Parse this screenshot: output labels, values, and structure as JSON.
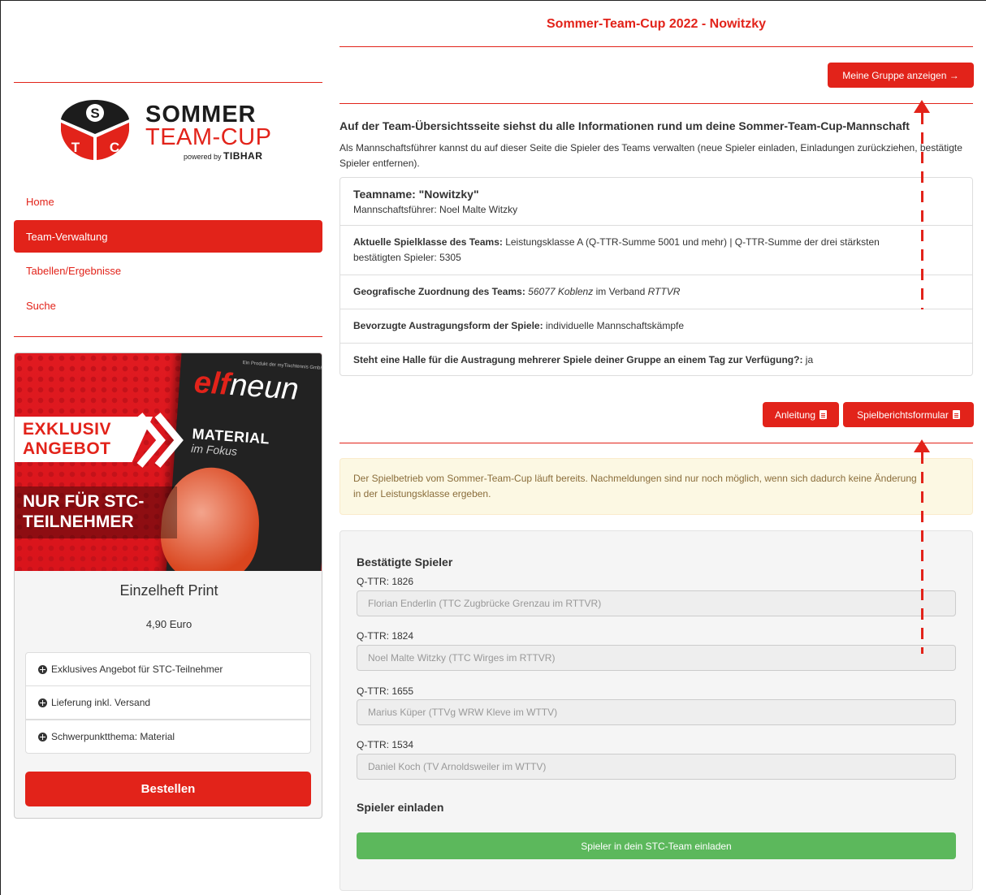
{
  "header": {
    "title": "Sommer-Team-Cup 2022 - Nowitzky"
  },
  "logo": {
    "line1": "SOMMER",
    "line2": "TEAM-CUP",
    "powered": "powered by",
    "brand": "TIBHAR",
    "letters": [
      "S",
      "T",
      "C"
    ]
  },
  "nav": {
    "items": [
      "Home",
      "Team-Verwaltung",
      "Tabellen/Ergebnisse",
      "Suche"
    ],
    "active_index": 1
  },
  "ad": {
    "badge1": "EXKLUSIV",
    "badge2": "ANGEBOT",
    "headline1": "NUR FÜR STC-",
    "headline2": "TEILNEHMER",
    "magazine_small": "Ein Produkt der myTischtennis GmbH",
    "magazine_title_a": "elf",
    "magazine_title_b": "neun",
    "magazine_topic": "MATERIAL",
    "magazine_sub": "im Fokus",
    "product": "Einzelheft Print",
    "price": "4,90 Euro",
    "features": [
      "Exklusives Angebot für STC-Teilnehmer",
      "Lieferung inkl. Versand",
      "Schwerpunktthema: Material"
    ],
    "order_button": "Bestellen"
  },
  "top_button": "Meine Gruppe anzeigen →",
  "overview": {
    "heading": "Auf der Team-Übersichtsseite siehst du alle Informationen rund um deine Sommer-Team-Cup-Mannschaft",
    "text": "Als Mannschaftsführer kannst du auf dieser Seite die Spieler des Teams verwalten (neue Spieler einladen, Einladungen zurückziehen, bestätigte Spieler entfernen)."
  },
  "team": {
    "name": "Teamname: \"Nowitzky\"",
    "captain": "Mannschaftsführer: Noel Malte Witzky",
    "class_label": "Aktuelle Spielklasse des Teams:",
    "class_value": " Leistungsklasse A (Q-TTR-Summe 5001 und mehr) | Q-TTR-Summe der drei stärksten bestätigten Spieler: 5305",
    "geo_label": "Geografische Zuordnung des Teams:",
    "geo_place": "56077 Koblenz",
    "geo_mid": " im Verband ",
    "geo_assoc": "RTTVR",
    "form_label": "Bevorzugte Austragungsform der Spiele:",
    "form_value": " individuelle Mannschaftskämpfe",
    "hall_label": "Steht eine Halle für die Austragung mehrerer Spiele deiner Gruppe an einem Tag zur Verfügung?:",
    "hall_value": " ja"
  },
  "doc_buttons": {
    "guide": "Anleitung",
    "report": "Spielberichtsformular"
  },
  "notice": "Der Spielbetrieb vom Sommer-Team-Cup läuft bereits. Nachmeldungen sind nur noch möglich, wenn sich dadurch keine Änderung in der Leistungsklasse ergeben.",
  "players": {
    "heading": "Bestätigte Spieler",
    "list": [
      {
        "qttr": "Q-TTR: 1826",
        "name": "Florian Enderlin (TTC Zugbrücke Grenzau im RTTVR)"
      },
      {
        "qttr": "Q-TTR: 1824",
        "name": "Noel Malte Witzky (TTC Wirges im RTTVR)"
      },
      {
        "qttr": "Q-TTR: 1655",
        "name": "Marius Küper (TTVg WRW Kleve im WTTV)"
      },
      {
        "qttr": "Q-TTR: 1534",
        "name": "Daniel Koch (TV Arnoldsweiler im WTTV)"
      }
    ],
    "invite_heading": "Spieler einladen",
    "invite_button": "Spieler in dein STC-Team einladen"
  },
  "colors": {
    "brand_red": "#e2231a",
    "invite_green": "#5cb85c",
    "notice_bg": "#fcf8e3",
    "notice_text": "#8a6d3b"
  }
}
